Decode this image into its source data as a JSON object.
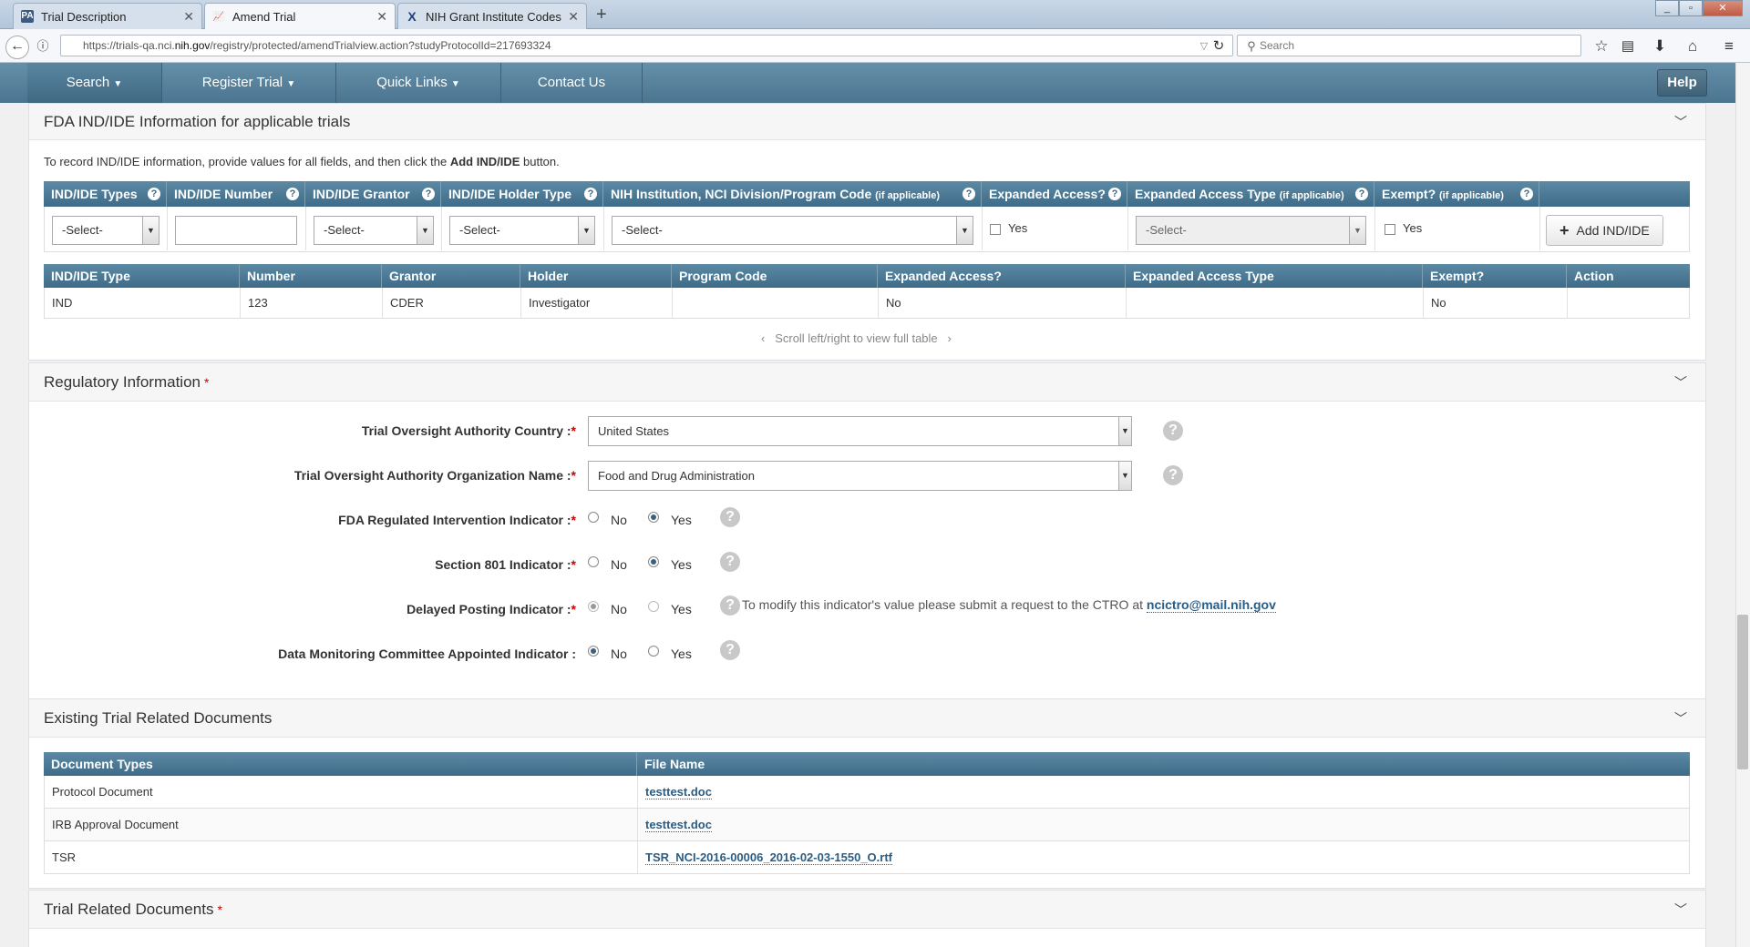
{
  "browser": {
    "tabs": [
      {
        "label": "Trial Description",
        "favicon": "PA"
      },
      {
        "label": "Amend Trial",
        "favicon": "chart"
      },
      {
        "label": "NIH Grant Institute Codes ...",
        "favicon": "X"
      }
    ],
    "url_prefix": "https://trials-qa.nci.",
    "url_domain": "nih.gov",
    "url_suffix": "/registry/protected/amendTrialview.action?studyProtocolId=217693324",
    "search_placeholder": "Search"
  },
  "appnav": {
    "items": [
      "Search",
      "Register Trial",
      "Quick Links",
      "Contact Us"
    ],
    "help": "Help"
  },
  "ind_section": {
    "title": "FDA IND/IDE Information for applicable trials",
    "instruction_pre": "To record IND/IDE information, provide values for all fields, and then click the ",
    "instruction_bold": "Add IND/IDE",
    "instruction_post": " button.",
    "form_headers": {
      "types": "IND/IDE Types",
      "number": "IND/IDE Number",
      "grantor": "IND/IDE Grantor",
      "holder_type": "IND/IDE Holder Type",
      "nih": "NIH Institution, NCI Division/Program Code",
      "nih_small": "(if applicable)",
      "expanded": "Expanded Access?",
      "expanded_type": "Expanded Access Type",
      "expanded_type_small": "(if applicable)",
      "exempt": "Exempt?",
      "exempt_small": "(if applicable)"
    },
    "select_default": "-Select-",
    "yes_label": "Yes",
    "add_button": "Add IND/IDE",
    "table_headers": [
      "IND/IDE Type",
      "Number",
      "Grantor",
      "Holder",
      "Program Code",
      "Expanded Access?",
      "Expanded Access Type",
      "Exempt?",
      "Action"
    ],
    "rows": [
      [
        "IND",
        "123",
        "CDER",
        "Investigator",
        "",
        "No",
        "",
        "No",
        ""
      ]
    ],
    "scroll_hint": "Scroll left/right to view full table"
  },
  "regulatory": {
    "title": "Regulatory Information",
    "country_label": "Trial Oversight Authority Country :",
    "country_value": "United States",
    "org_label": "Trial Oversight Authority Organization Name :",
    "org_value": "Food and Drug Administration",
    "fda_label": "FDA Regulated Intervention Indicator :",
    "sec801_label": "Section 801 Indicator :",
    "delayed_label": "Delayed Posting Indicator :",
    "dmc_label": "Data Monitoring Committee Appointed Indicator :",
    "no": "No",
    "yes": "Yes",
    "star": "*",
    "delayed_note": "To modify this indicator's value please submit a request to the CTRO at ",
    "delayed_email": "ncictro@mail.nih.gov"
  },
  "existing_docs": {
    "title": "Existing Trial Related Documents",
    "headers": [
      "Document Types",
      "File Name"
    ],
    "rows": [
      {
        "type": "Protocol Document",
        "file": "testtest.doc"
      },
      {
        "type": "IRB Approval Document",
        "file": "testtest.doc"
      },
      {
        "type": "TSR",
        "file": "TSR_NCI-2016-00006_2016-02-03-1550_O.rtf"
      }
    ]
  },
  "trial_docs": {
    "title": "Trial Related Documents"
  }
}
